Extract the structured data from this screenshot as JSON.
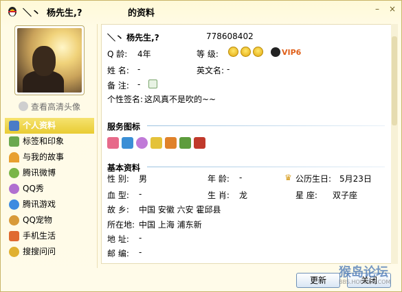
{
  "title": {
    "name": "＼丶  杨先生,?",
    "suffix": "的资料"
  },
  "window_buttons": {
    "minimize": "–",
    "close": "×"
  },
  "left": {
    "hd_link": "查看高清头像",
    "nav": [
      {
        "label": "个人资料",
        "icon": "profile-card-icon",
        "color": "#4a7cc7"
      },
      {
        "label": "标签和印象",
        "icon": "tag-icon",
        "color": "#6aa84f"
      },
      {
        "label": "与我的故事",
        "icon": "rainbow-icon",
        "color": "#e8a030"
      },
      {
        "label": "腾讯微博",
        "icon": "weibo-icon",
        "color": "#79b548"
      },
      {
        "label": "QQ秀",
        "icon": "qqshow-icon",
        "color": "#b070d0"
      },
      {
        "label": "腾讯游戏",
        "icon": "game-icon",
        "color": "#3d8be0"
      },
      {
        "label": "QQ宠物",
        "icon": "pet-icon",
        "color": "#d89a3a"
      },
      {
        "label": "手机生活",
        "icon": "phone-life-icon",
        "color": "#e06a30"
      },
      {
        "label": "搜搜问问",
        "icon": "soso-icon",
        "color": "#e0b030"
      }
    ]
  },
  "profile": {
    "name": "＼丶  杨先生,?",
    "qq": "778608402",
    "q_age_label": "Q    龄:",
    "q_age": "4年",
    "level_label": "等    级:",
    "vip": "VIP6",
    "surname_label": "姓    名:",
    "surname": "-",
    "english_label": "英文名:",
    "english": "-",
    "remark_label": "备    注:",
    "remark": "-",
    "signature_label": "个性签名:",
    "signature": "这风真不是吹的~~"
  },
  "services": {
    "title": "服务图标"
  },
  "basic": {
    "title": "基本资料",
    "gender_label": "性    别:",
    "gender": "男",
    "age_label": "年    龄:",
    "age": "-",
    "birthday_label": "公历生日:",
    "birthday": "5月23日",
    "blood_label": "血    型:",
    "blood": "-",
    "zodiac_label": "生    肖:",
    "zodiac": "龙",
    "star_label": "星    座:",
    "star": "双子座",
    "hometown_label": "故    乡:",
    "hometown": "中国 安徽 六安 霍邱县",
    "location_label": "所在地:",
    "location": "中国 上海 浦东新",
    "address_label": "地    址:",
    "address": "-",
    "postcode_label": "邮    编:",
    "postcode": "-"
  },
  "buttons": {
    "refresh": "更新",
    "close": "关闭"
  },
  "watermark": {
    "main": "猴岛论坛",
    "sub": "BBS.HOUDAO.COM"
  }
}
